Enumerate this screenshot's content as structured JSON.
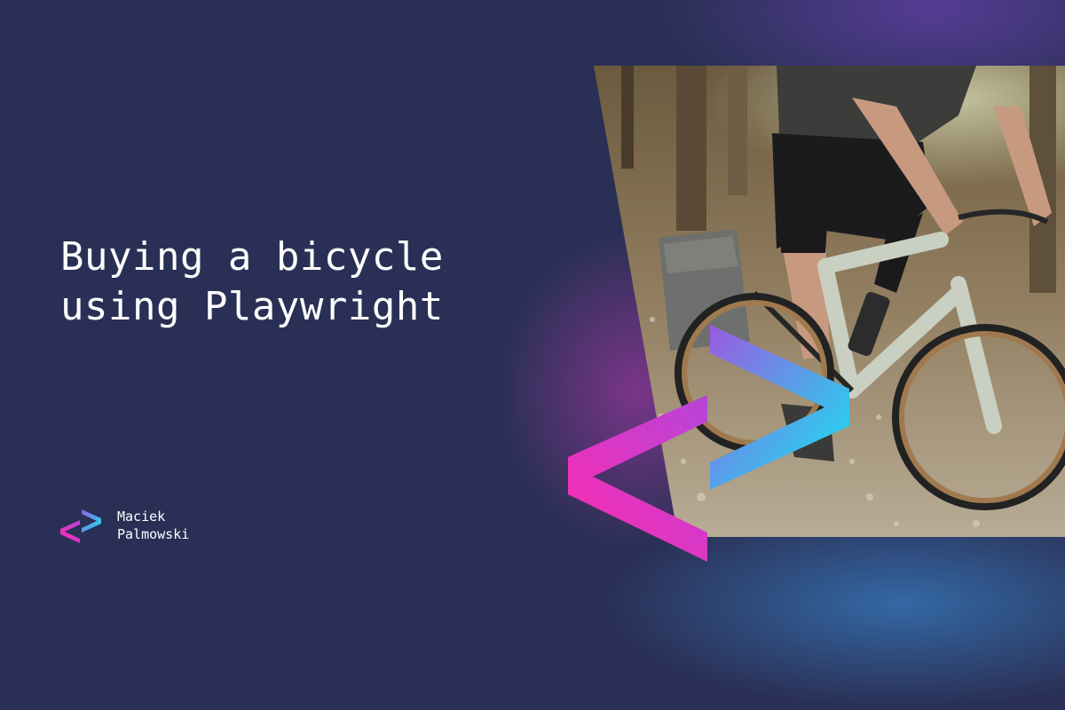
{
  "title": {
    "line1": "Buying a bicycle",
    "line2": "using Playwright"
  },
  "author": {
    "first_name": "Maciek",
    "last_name": "Palmowski",
    "logo_icon": "code-brackets-logo-icon"
  },
  "hero": {
    "image_icon": "cyclist-on-gravel-bike-photo",
    "brackets_icon": "code-brackets-icon"
  },
  "colors": {
    "background": "#2a3055",
    "text": "#ffffff",
    "accent_pink": "#f02aa8",
    "accent_purple": "#9b4fd6",
    "accent_cyan": "#14e3f0"
  }
}
